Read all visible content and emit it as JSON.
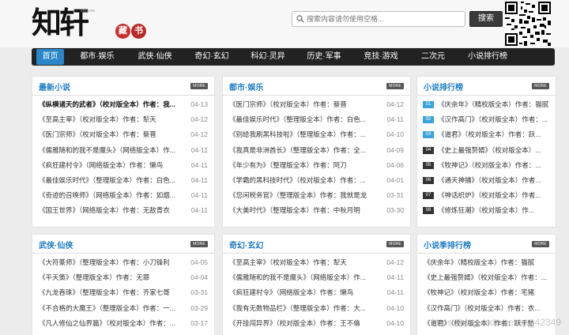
{
  "header": {
    "logo_text": "知轩",
    "logo_seal": [
      "藏",
      "书"
    ],
    "logo_small": "zxcs.me",
    "search_placeholder": "搜索内容请勿使用空格...",
    "search_button": "搜索"
  },
  "nav": {
    "items": [
      "首页",
      "都市·娱乐",
      "武侠·仙侠",
      "奇幻·玄幻",
      "科幻·灵异",
      "历史·军事",
      "竞技·游戏",
      "二次元",
      "小说排行榜"
    ],
    "active_index": 0
  },
  "more_label": "MORE",
  "panels": {
    "latest": {
      "title": "最新小说",
      "rows": [
        {
          "t": "《纵横诸天的武者》（校对版全本）作者：我...",
          "d": "04-13"
        },
        {
          "t": "《至高主宰》（校对版全本）作者：犁天",
          "d": "04-12"
        },
        {
          "t": "《医门宗师》（校对版全本）作者：蔡晋",
          "d": "04-12"
        },
        {
          "t": "《儒雅随和的我不是魔头》（网络版全本）作...",
          "d": "04-11"
        },
        {
          "t": "《疯狂建村令》（网络版全本）作者：懒鸟",
          "d": "04-11"
        },
        {
          "t": "《最佳娱乐时代》（整理版全本）作者：白色...",
          "d": "04-11"
        },
        {
          "t": "《奇迹的召唤师》（网络版全本）作者：如烟...",
          "d": "04-11"
        },
        {
          "t": "《国王世界》（网络版全本）作者：无敌青衣",
          "d": "04-11"
        }
      ]
    },
    "urban": {
      "title": "都市·娱乐",
      "rows": [
        {
          "t": "《医门宗师》（校对版全本）作者：蔡晋",
          "d": "04-12"
        },
        {
          "t": "《最佳娱乐时代》（整理版全本）作者：白色...",
          "d": "04-11"
        },
        {
          "t": "《别给我刷黑科技啦》（整理版全本）作者：...",
          "d": "04-10"
        },
        {
          "t": "《我真是非洲酋长》（整理版全本）作者：全...",
          "d": "04-09"
        },
        {
          "t": "《年少有为》（整理版全本）作者：阿刀",
          "d": "04-06"
        },
        {
          "t": "《学霸的黑科技时代》（校对版全本）作者：...",
          "d": "04-01"
        },
        {
          "t": "《您闲税务官》（整理版全本）作者：我就是龙",
          "d": "03-31"
        },
        {
          "t": "《大美时代》（整理版全本）作者：中秋月明",
          "d": "03-30"
        }
      ]
    },
    "rank": {
      "title": "小说排行榜",
      "rows": [
        {
          "n": "01",
          "t": "《庆余年》（精校版全本）作者：猫腻"
        },
        {
          "n": "02",
          "t": "《汉作高门》（校对版全本）作者：..."
        },
        {
          "n": "03",
          "t": "《道君》（校对版全本）作者：跃..."
        },
        {
          "n": "04",
          "t": "《史上最强赘婿》（校对版全本）..."
        },
        {
          "n": "05",
          "t": "《牧神记》（校对版全本）作者：..."
        },
        {
          "n": "06",
          "t": "《通天神捕》（校对版全本）作者..."
        },
        {
          "n": "07",
          "t": "《神话织炉》（校对版全本）作者..."
        },
        {
          "n": "08",
          "t": "《修炼狂潮》（校对版全本）作..."
        }
      ]
    },
    "wuxia": {
      "title": "武侠·仙侠",
      "rows": [
        {
          "t": "《大符篆师》（整理版全本）作者：小刀锋利",
          "d": "04-05"
        },
        {
          "t": "《平天策》（整理版全本）作者：无罪",
          "d": "04-04"
        },
        {
          "t": "《九龙吞珠》（整理版全本）作者：齐家七哥",
          "d": "03-31"
        },
        {
          "t": "《不合格的大魔王》（整理版全本）作者：一...",
          "d": "03-29"
        },
        {
          "t": "《凡人修仙之仙界篇》（校对版全本）作者：...",
          "d": "03-17"
        }
      ]
    },
    "fantasy": {
      "title": "奇幻·玄幻",
      "rows": [
        {
          "t": "《至高主宰》（校对版全本）作者：犁天",
          "d": "04-12"
        },
        {
          "t": "《儒雅随和的我不是魔头》（网络版全本）作...",
          "d": "04-11"
        },
        {
          "t": "《疯狂建村令》（网络版全本）作者：懒鸟",
          "d": "04-11"
        },
        {
          "t": "《我有无数物品栏》（整理版全本）作者：大...",
          "d": "04-10"
        },
        {
          "t": "《开挂闯异界》（校对版全本）作者：王不倫",
          "d": "04-10"
        }
      ]
    },
    "season": {
      "title": "小说季排行榜",
      "rows": [
        {
          "t": "《庆余年》（精校版全本）作者：猫腻"
        },
        {
          "t": "《史上最强赘婿》（校对版全本）作者：..."
        },
        {
          "t": "《牧神记》（校对版全本）作者：宅猪"
        },
        {
          "t": "《汉作高门》（校对版全本）作者：衣..."
        },
        {
          "t": "《道君》（校对版全本）作者：跃千愁"
        }
      ]
    }
  },
  "watermark": "https://blog.csdn.net/qq_42349"
}
